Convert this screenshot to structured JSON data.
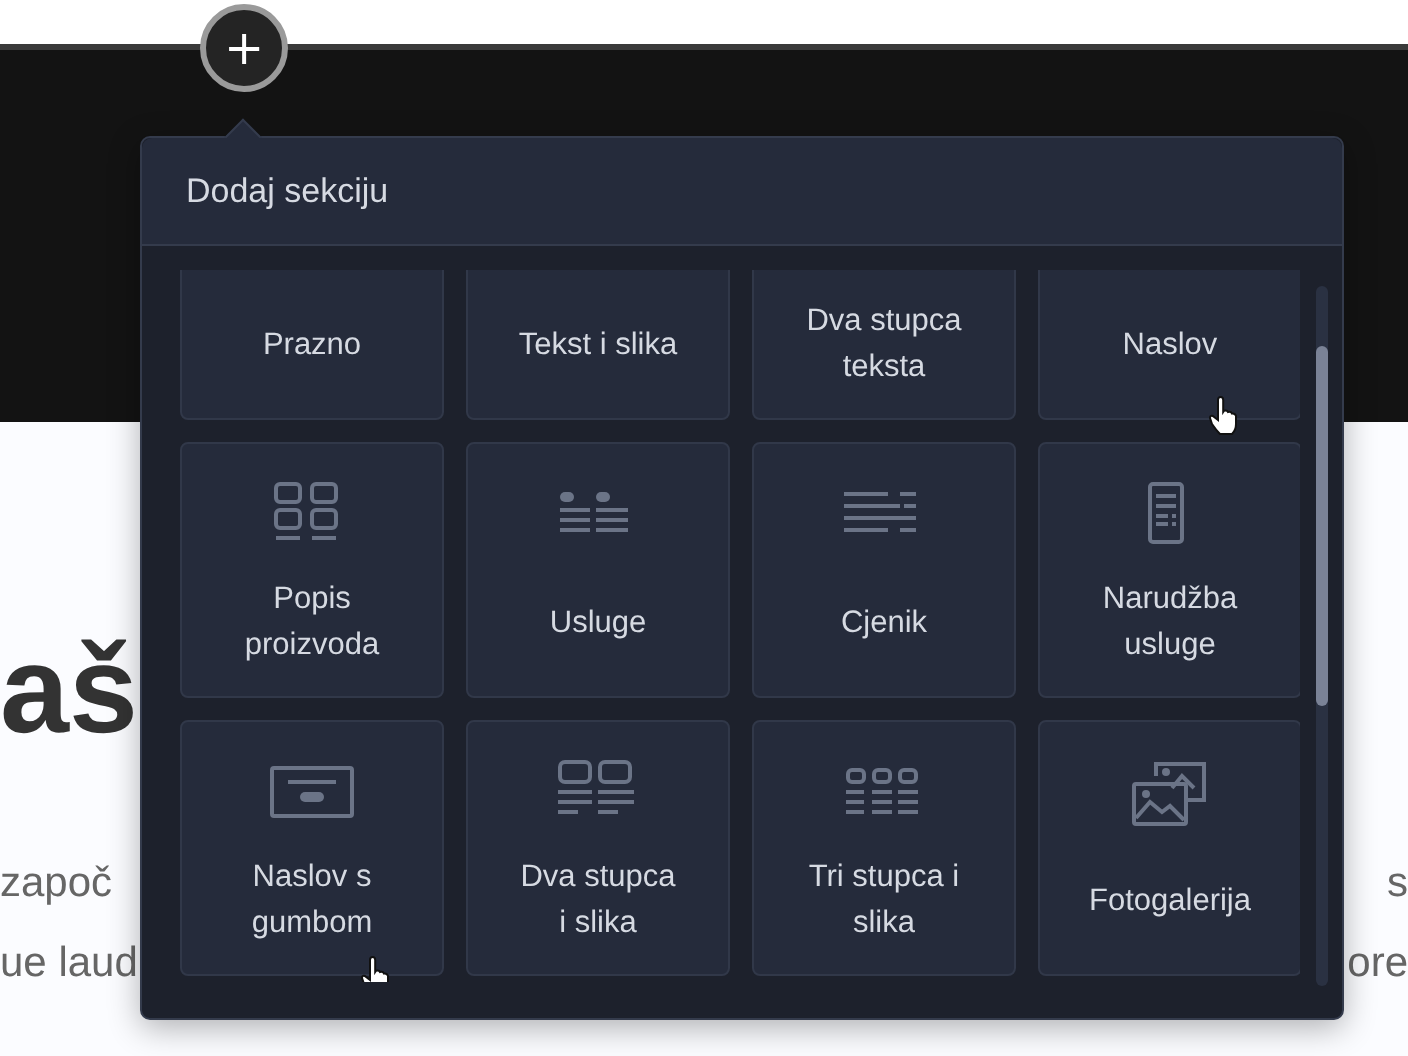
{
  "page": {
    "heading": "aš",
    "text_left": [
      "započ",
      "ue laud"
    ],
    "text_right": [
      "s",
      "ore"
    ]
  },
  "add_button": {
    "label": "+"
  },
  "popup": {
    "title": "Dodaj sekciju",
    "rows": [
      {
        "cut_off": true,
        "items": [
          {
            "label": "Prazno"
          },
          {
            "label": "Tekst i slika"
          },
          {
            "label": "Dva stupca teksta"
          },
          {
            "label": "Naslov"
          }
        ]
      },
      {
        "cut_off": false,
        "items": [
          {
            "label": "Popis proizvoda"
          },
          {
            "label": "Usluge"
          },
          {
            "label": "Cjenik"
          },
          {
            "label": "Narudžba usluge"
          }
        ]
      },
      {
        "cut_off": false,
        "items": [
          {
            "label": "Naslov s gumbom"
          },
          {
            "label": "Dva stupca i slika"
          },
          {
            "label": "Tri stupca i slika"
          },
          {
            "label": "Fotogalerija"
          }
        ]
      }
    ]
  }
}
